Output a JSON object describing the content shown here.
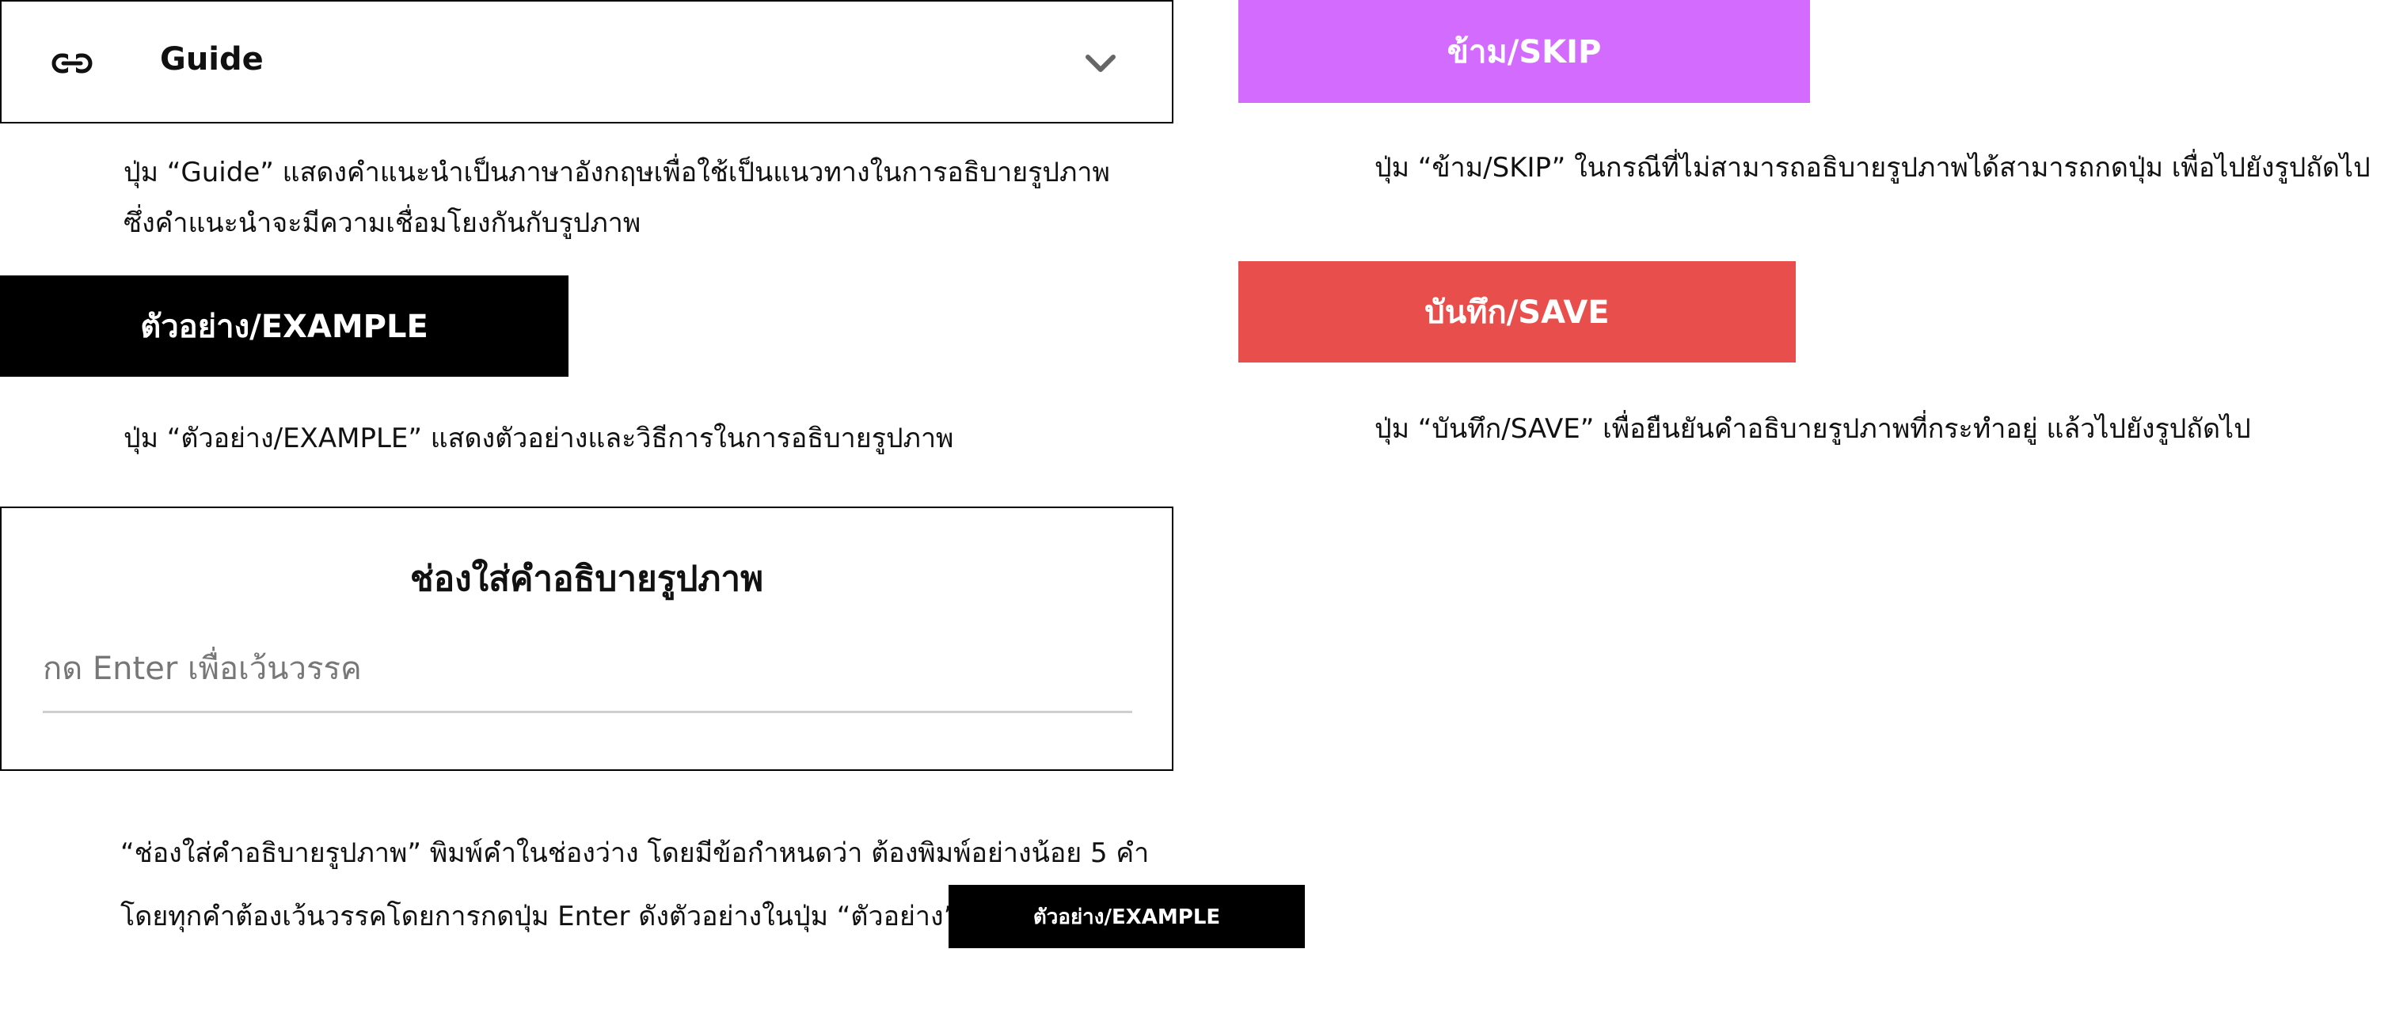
{
  "guide": {
    "title": "Guide",
    "icon": "link-icon",
    "toggle_icon": "chevron-down-icon",
    "description_line1": "ปุ่ม “Guide” แสดงคำแนะนำเป็นภาษาอังกฤษเพื่อใช้เป็นแนวทางในการอธิบายรูปภาพ",
    "description_line2": "ซึ่งคำแนะนำจะมีความเชื่อมโยงกันกับรูปภาพ"
  },
  "example": {
    "button_label": "ตัวอย่าง/EXAMPLE",
    "description": "ปุ่ม “ตัวอย่าง/EXAMPLE” แสดงตัวอย่างและวิธีการในการอธิบายรูปภาพ"
  },
  "description_panel": {
    "title": "ช่องใส่คำอธิบายรูปภาพ",
    "input_value": "",
    "input_placeholder": "กด Enter เพื่อเว้นวรรค",
    "help_line1": "“ช่องใส่คำอธิบายรูปภาพ” พิมพ์คำในช่องว่าง โดยมีข้อกำหนดว่า ต้องพิมพ์อย่างน้อย 5 คำ",
    "help_line2": "โดยทุกคำต้องเว้นวรรคโดยการกดปุ่ม Enter ดังตัวอย่างในปุ่ม “ตัวอย่าง”",
    "example_button_label": "ตัวอย่าง/EXAMPLE"
  },
  "skip": {
    "button_label": "ข้าม/SKIP",
    "description": "ปุ่ม “ข้าม/SKIP” ในกรณีที่ไม่สามารถอธิบายรูปภาพได้สามารถกดปุ่ม เพื่อไปยังรูปถัดไป",
    "color": "#d36bff"
  },
  "save": {
    "button_label": "บันทึก/SAVE",
    "description": "ปุ่ม “บันทึก/SAVE” เพื่อยืนยันคำอธิบายรูปภาพที่กระทำอยู่ แล้วไปยังรูปถัดไป",
    "color": "#e84f4c"
  }
}
